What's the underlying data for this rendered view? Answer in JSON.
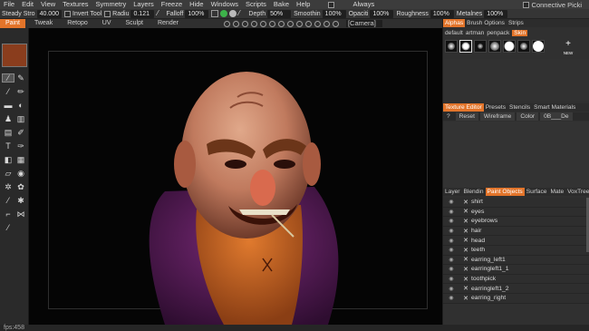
{
  "menu": {
    "items": [
      "File",
      "Edit",
      "View",
      "Textures",
      "Symmetry",
      "Layers",
      "Freeze",
      "Hide",
      "Windows",
      "Scripts",
      "Bake",
      "Help"
    ],
    "always_label": "Always",
    "connective_label": "Connective Picki"
  },
  "toolbar": {
    "steady_label": "Steady Stro",
    "steady_value": "40.000",
    "invert_label": "Invert Tool",
    "radius_label": "Radiu",
    "radius_value": "0.121",
    "falloff_label": "Falloff",
    "falloff_value": "100%",
    "depth_label": "Depth",
    "depth_value": "50%",
    "smoothing_label": "Smoothin",
    "smoothing_value": "100%",
    "opacity_label": "Opaciti",
    "opacity_value": "100%",
    "roughness_label": "Roughness",
    "roughness_value": "100%",
    "metalness_label": "Metalnes",
    "metalness_value": "100%"
  },
  "rooms": {
    "tabs": [
      "Paint",
      "Tweak",
      "Retopo",
      "UV",
      "Sculpt",
      "Render"
    ],
    "active": "Paint",
    "camera_label": "[Camera]"
  },
  "alphas": {
    "tabs": [
      "Alphas",
      "Brush Options",
      "Strips"
    ],
    "active_tab": "Alphas",
    "subtabs": [
      "default",
      "artman",
      "penpack",
      "Skin"
    ],
    "active_subtab": "Skin",
    "new_label": "NEW"
  },
  "texture_editor": {
    "tabs": [
      "Texture Editor",
      "Presets",
      "Stencils",
      "Smart Materials"
    ],
    "active_tab": "Texture Editor",
    "controls": [
      "?",
      "Reset",
      "Wireframe",
      "Color",
      "0B___De"
    ]
  },
  "objects_panel": {
    "tabs": [
      "Layer",
      "Blendin",
      "Paint Objects",
      "Surface",
      "Mate",
      "VoxTree"
    ],
    "active_tab": "Paint Objects",
    "items": [
      "shirt",
      "eyes",
      "eyebrows",
      "hair",
      "head",
      "teeth",
      "earring_left1",
      "earringleft1_1",
      "toothpick",
      "earringleft1_2",
      "earring_right"
    ]
  },
  "status": {
    "fps": "fps:458"
  },
  "colors": {
    "accent": "#e2742a",
    "primary_swatch": "#8a3d1d"
  }
}
